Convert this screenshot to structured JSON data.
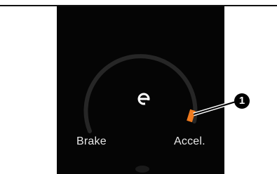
{
  "gauge": {
    "center_icon": "eco-e-icon",
    "brake_label": "Brake",
    "accel_label": "Accel.",
    "arc_color": "#2a2a2a",
    "indicator_color": "#ef7a1e"
  },
  "callout": {
    "number": "1"
  }
}
